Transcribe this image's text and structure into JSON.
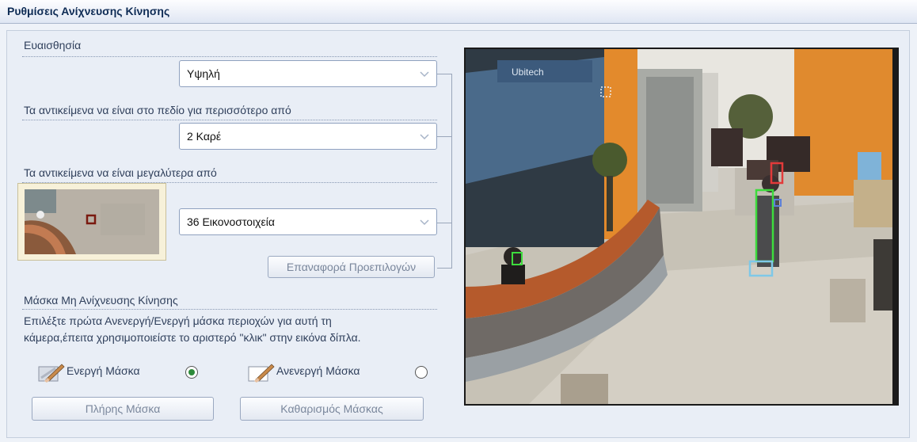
{
  "window": {
    "title": "Ρυθμίσεις Ανίχνευσης Κίνησης"
  },
  "sensitivity": {
    "label": "Ευαισθησία",
    "value": "Υψηλή"
  },
  "duration": {
    "label": "Τα αντικείμενα να είναι στο πεδίο για περισσότερο από",
    "value": "2 Καρέ"
  },
  "size": {
    "label": "Τα αντικείμενα να είναι μεγαλύτερα από",
    "value": "36 Εικονοστοιχεία"
  },
  "reset_button": "Επαναφορά Προεπιλογών",
  "mask": {
    "title": "Μάσκα Μη Ανίχνευσης Κίνησης",
    "instructions_line1": "Επιλέξτε πρώτα Ανενεργή/Ενεργή μάσκα περιοχών για αυτή τη",
    "instructions_line2": "κάμερα,έπειτα χρησιμοποιείστε το αριστερό \"κλικ\" στην εικόνα δίπλα.",
    "active_label": "Ενεργή Μάσκα",
    "inactive_label": "Ανενεργή Μάσκα",
    "active_selected": true,
    "full_mask_button": "Πλήρης Μάσκα",
    "clear_mask_button": "Καθαρισμός Μάσκας"
  },
  "camera": {
    "logo_text": "Ubitech",
    "detection_box_colors": [
      "#e23a3a",
      "#3ddc3d",
      "#7ec8e8",
      "#5b7fd8"
    ]
  },
  "icons": {
    "dropdown": "chevron-down-icon",
    "active_mask": "eraser-brush-icon",
    "inactive_mask": "brush-icon"
  }
}
